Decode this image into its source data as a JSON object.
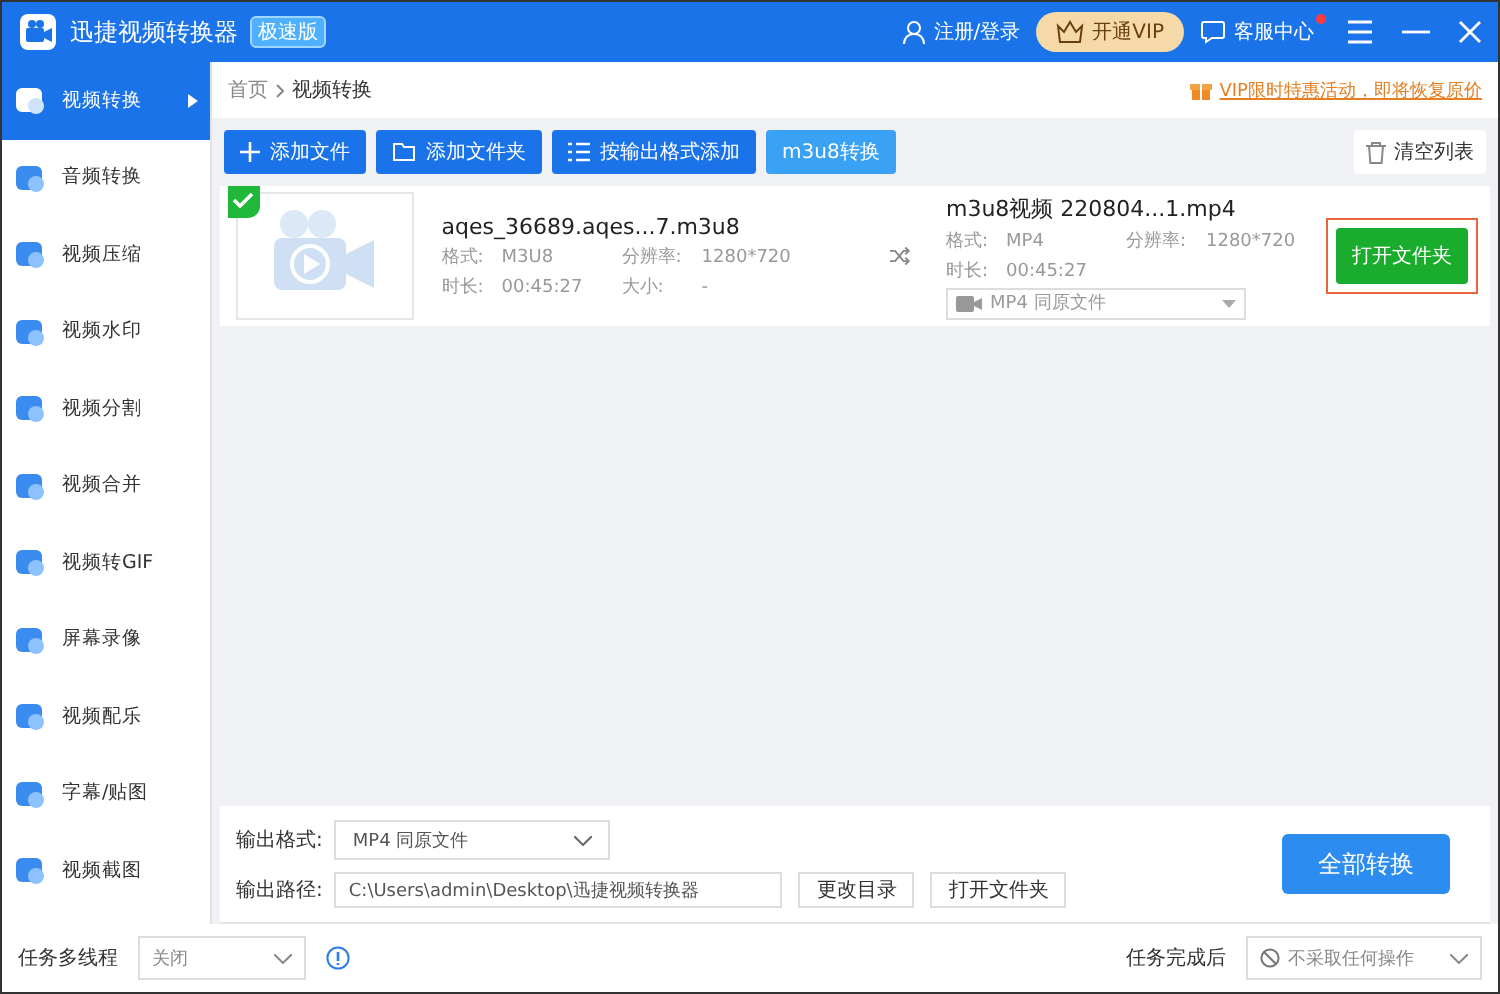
{
  "title_bar": {
    "app_name": "迅捷视频转换器",
    "edition_badge": "极速版",
    "login": "注册/登录",
    "vip_button": "开通VIP",
    "support": "客服中心",
    "support_unread": true
  },
  "sidebar": {
    "items": [
      {
        "label": "视频转换",
        "selected": true
      },
      {
        "label": "音频转换",
        "selected": false
      },
      {
        "label": "视频压缩",
        "selected": false
      },
      {
        "label": "视频水印",
        "selected": false
      },
      {
        "label": "视频分割",
        "selected": false
      },
      {
        "label": "视频合并",
        "selected": false
      },
      {
        "label": "视频转GIF",
        "selected": false
      },
      {
        "label": "屏幕录像",
        "selected": false
      },
      {
        "label": "视频配乐",
        "selected": false
      },
      {
        "label": "字幕/贴图",
        "selected": false
      },
      {
        "label": "视频截图",
        "selected": false
      }
    ]
  },
  "breadcrumb": [
    "首页",
    "视频转换"
  ],
  "promo": "VIP限时特惠活动，即将恢复原价",
  "toolbar": {
    "buttons": [
      {
        "label": "添加文件",
        "kind": "add"
      },
      {
        "label": "添加文件夹",
        "kind": "folder"
      },
      {
        "label": "按输出格式添加",
        "kind": "list"
      },
      {
        "label": "m3u8转换",
        "kind": "plain"
      }
    ],
    "clear_button": "清空列表"
  },
  "files": [
    {
      "done": true,
      "source": {
        "name": "aqes_36689.aqes...7.m3u8",
        "fields": [
          {
            "label": "格式:",
            "value": "M3U8"
          },
          {
            "label": "分辨率:",
            "value": "1280*720"
          },
          {
            "label": "时长:",
            "value": "00:45:27"
          },
          {
            "label": "大小:",
            "value": "-"
          }
        ]
      },
      "target": {
        "name": "m3u8视频 220804...1.mp4",
        "fields": [
          {
            "label": "格式:",
            "value": "MP4"
          },
          {
            "label": "分辨率:",
            "value": "1280*720"
          },
          {
            "label": "时长:",
            "value": "00:45:27"
          }
        ],
        "format_select": "MP4  同原文件"
      },
      "action": "打开文件夹",
      "highlighted": true
    }
  ],
  "output": {
    "format_label": "输出格式:",
    "format_value": "MP4  同原文件",
    "path_label": "输出路径:",
    "path_value": "C:\\Users\\admin\\Desktop\\迅捷视频转换器",
    "change_dir": "更改目录",
    "open_folder": "打开文件夹",
    "convert_all": "全部转换"
  },
  "status_bar": {
    "multithread_label": "任务多线程",
    "multithread_value": "关闭",
    "after_label": "任务完成后",
    "after_value": "不采取任何操作"
  }
}
